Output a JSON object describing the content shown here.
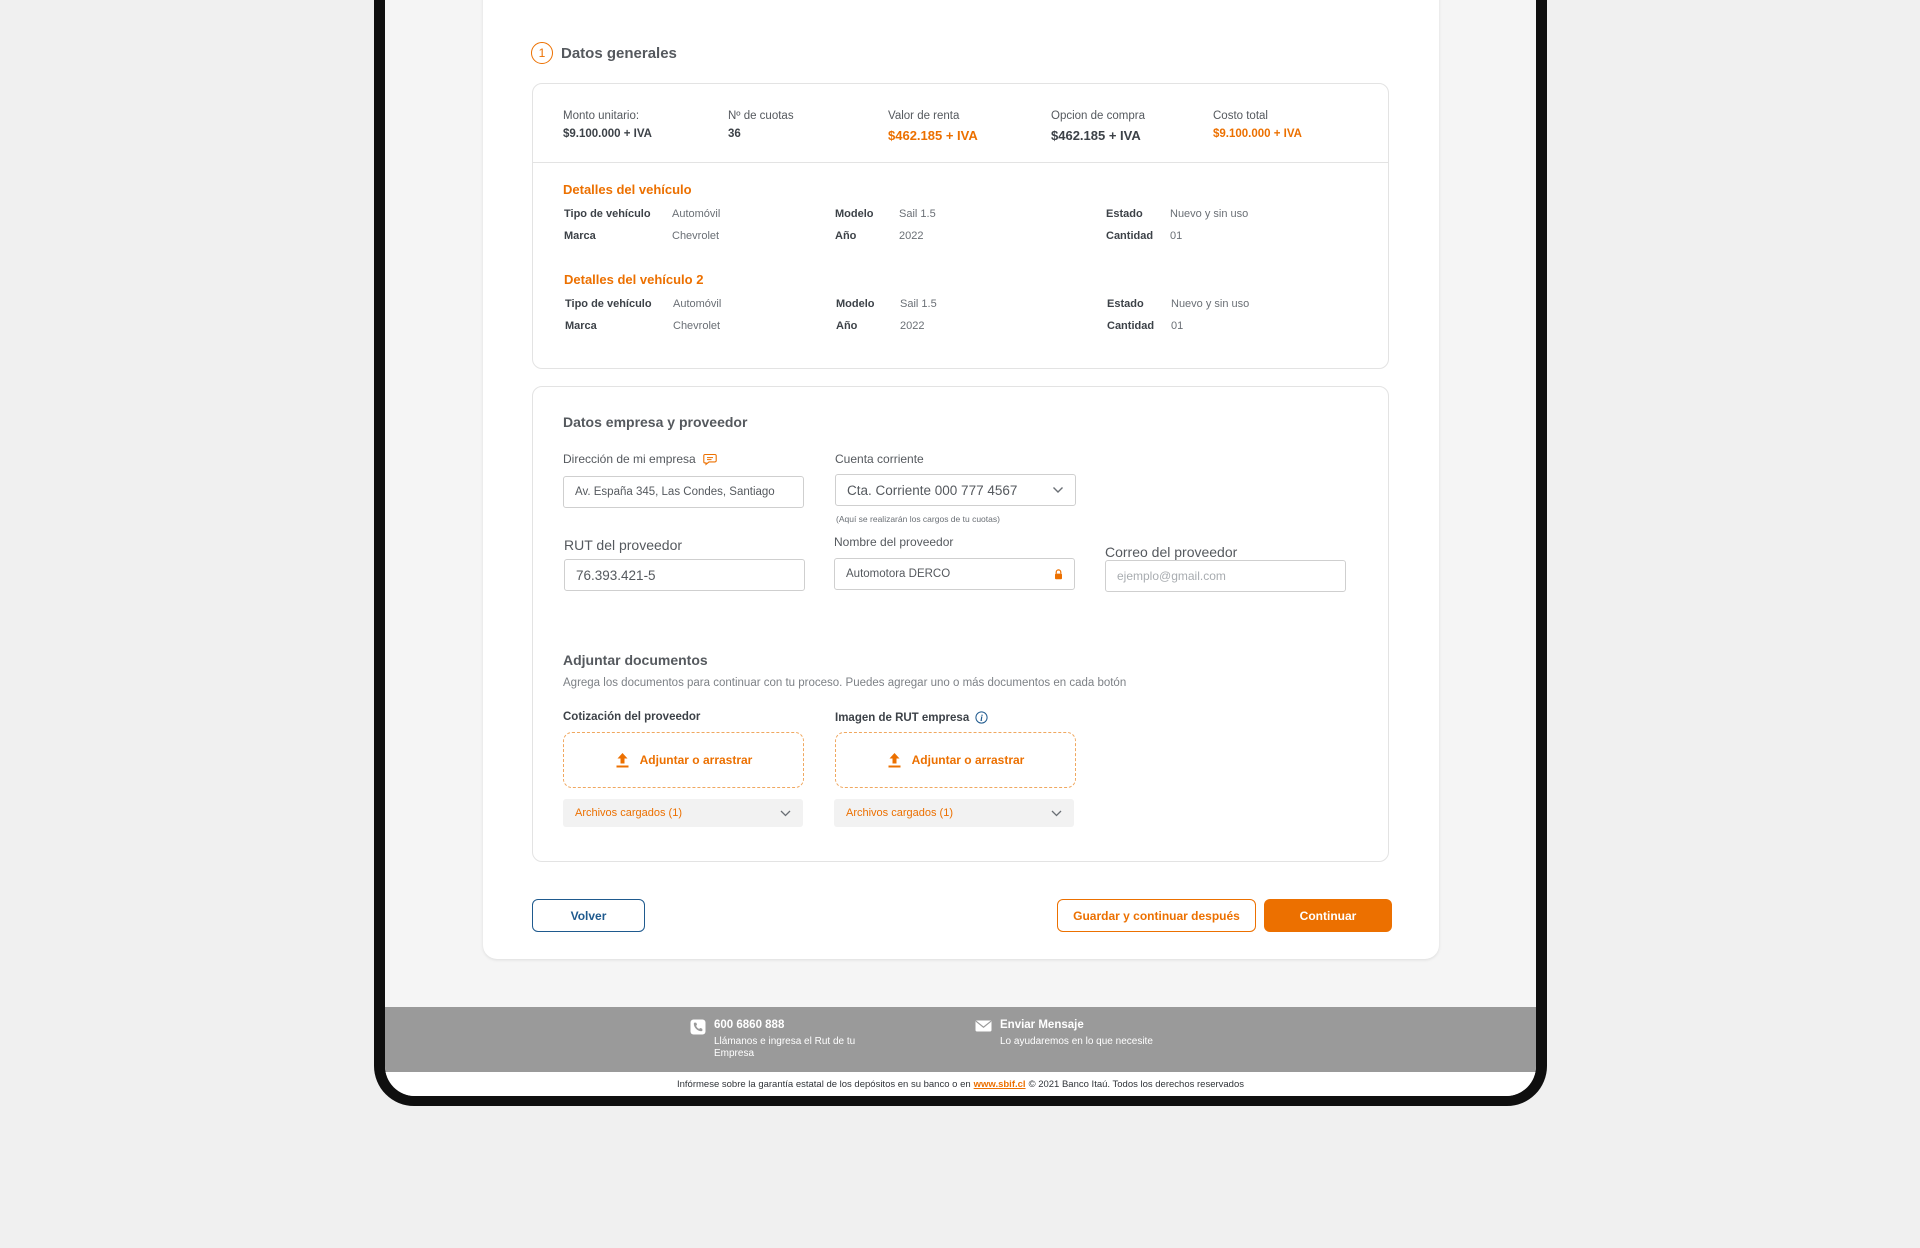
{
  "section": {
    "step": "1",
    "title": "Datos generales"
  },
  "summary": {
    "monto_label": "Monto unitario:",
    "monto_value": "$9.100.000 + IVA",
    "cuotas_label": "Nº de cuotas",
    "cuotas_value": "36",
    "renta_label": "Valor de renta",
    "renta_value": "$462.185 + IVA",
    "opcion_label": "Opcion de compra",
    "opcion_value": "$462.185 + IVA",
    "costo_label": "Costo total",
    "costo_value": "$9.100.000 + IVA"
  },
  "vehicles": [
    {
      "title": "Detalles del vehículo",
      "tipo_label": "Tipo de vehículo",
      "tipo_value": "Automóvil",
      "marca_label": "Marca",
      "marca_value": "Chevrolet",
      "modelo_label": "Modelo",
      "modelo_value": "Sail 1.5",
      "anio_label": "Año",
      "anio_value": "2022",
      "estado_label": "Estado",
      "estado_value": "Nuevo y sin uso",
      "cantidad_label": "Cantidad",
      "cantidad_value": "01"
    },
    {
      "title": "Detalles del vehículo 2",
      "tipo_label": "Tipo de vehículo",
      "tipo_value": "Automóvil",
      "marca_label": "Marca",
      "marca_value": "Chevrolet",
      "modelo_label": "Modelo",
      "modelo_value": "Sail 1.5",
      "anio_label": "Año",
      "anio_value": "2022",
      "estado_label": "Estado",
      "estado_value": "Nuevo y sin uso",
      "cantidad_label": "Cantidad",
      "cantidad_value": "01"
    }
  ],
  "empresa": {
    "title": "Datos empresa y proveedor",
    "direccion_label": "Dirección de mi empresa",
    "direccion_value": "Av. España 345, Las Condes, Santiago",
    "cuenta_label": "Cuenta corriente",
    "cuenta_value": "Cta. Corriente 000 777 4567",
    "cuenta_hint": "(Aquí se realizarán los cargos de tu cuotas)",
    "rut_label": "RUT del proveedor",
    "rut_value": "76.393.421-5",
    "nombre_label": "Nombre del proveedor",
    "nombre_value": "Automotora DERCO",
    "correo_label": "Correo del proveedor",
    "correo_placeholder": "ejemplo@gmail.com"
  },
  "documentos": {
    "title": "Adjuntar documentos",
    "help": "Agrega los documentos para continuar con tu proceso. Puedes agregar uno o más documentos en cada botón",
    "cotizacion_label": "Cotización del proveedor",
    "rut_label": "Imagen de RUT empresa",
    "attach_label": "Adjuntar o arrastrar",
    "files_label": "Archivos cargados (1)"
  },
  "buttons": {
    "back": "Volver",
    "save": "Guardar y continuar después",
    "continue": "Continuar"
  },
  "footer": {
    "phone_title": "600 6860 888",
    "phone_sub": "Llámanos e ingresa el Rut de tu Empresa",
    "message_title": "Enviar Mensaje",
    "message_sub": "Lo ayudaremos en lo que necesite",
    "legal_pre": "Infórmese sobre la garantía estatal de los depósitos en su banco o en",
    "legal_link": "www.sbif.cl",
    "legal_post": "© 2021 Banco Itaú. Todos los derechos reservados"
  },
  "colors": {
    "accent": "#ec7000",
    "secondary": "#1f5a8e",
    "footer_bg": "#9a9a9a"
  }
}
